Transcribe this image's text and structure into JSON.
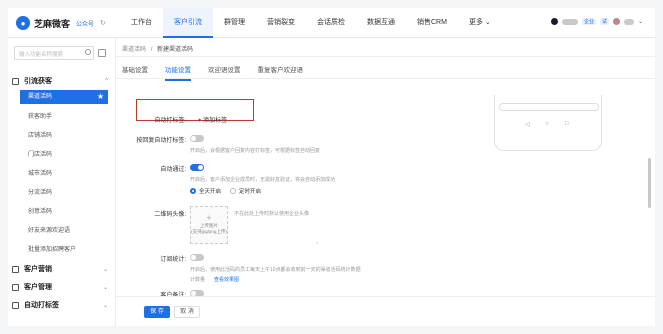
{
  "header": {
    "logo_text": "芝麻微客",
    "logo_sub": "公众号",
    "nav": [
      "工作台",
      "客户引流",
      "群管理",
      "营销裂变",
      "会话质检",
      "数据互通",
      "销售CRM",
      "更多 ⌄"
    ],
    "user_chip": "企业",
    "user_chip2": "试"
  },
  "sidebar": {
    "search_placeholder": "输入功能名称搜索",
    "sections": {
      "traffic": "引流获客",
      "marketing": "客户营销",
      "customer": "客户管理",
      "autotag": "自动打标签"
    },
    "items": [
      "渠道活码",
      "获客助手",
      "店铺活码",
      "门店活码",
      "城市活码",
      "分流活码",
      "创意活码",
      "好友来源欢迎语",
      "批量添加招聘客户"
    ]
  },
  "breadcrumb": {
    "parent": "渠道活码",
    "sep": "/",
    "current": "新建渠道活码"
  },
  "tabs": [
    "基础设置",
    "功能设置",
    "欢迎语设置",
    "重复客户欢迎语"
  ],
  "form": {
    "auto_tag_label": "自动打标签:",
    "add_tag": "+ 添加标签",
    "tag_by_reply_label": "按回复自动打标签:",
    "tag_by_reply_hint": "开启后，会根据客户回复内容打标签，可根据标签自动回复",
    "auto_pass_label": "自动通过:",
    "auto_pass_hint": "开启后，客户添加企业成员时，无需好友验证，将会自动添加成功",
    "radio_all": "全天开启",
    "radio_timed": "定时开启",
    "qr_avatar_label": "二维码头像:",
    "qr_avatar_hint": "不在此处上传时默认使用企业头像",
    "upload_line1": "上传图片",
    "upload_line2": "(支持jpg/png上传)",
    "subscribe_label": "订阅统计:",
    "subscribe_hint": "开启后，使用此活码的员工每天上午10点都会收到前一天的渠道活码统计数据",
    "count_link": "计数量",
    "view_sample_link": "查看效果图",
    "remark_label": "客户备注:"
  },
  "footer": {
    "save": "保 存",
    "cancel": "取 消"
  },
  "colors": {
    "accent": "#1f6fe5",
    "highlight_box": "#c0392b"
  }
}
